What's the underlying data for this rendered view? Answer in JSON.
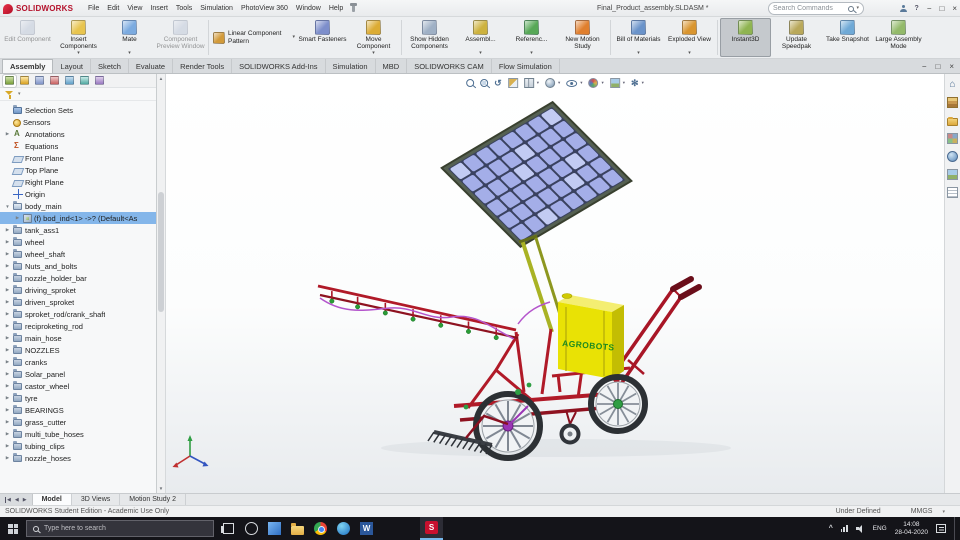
{
  "titlebar": {
    "logo_text": "SOLIDWORKS",
    "menus": [
      "File",
      "Edit",
      "View",
      "Insert",
      "Tools",
      "Simulation",
      "PhotoView 360",
      "Window",
      "Help"
    ],
    "document_title": "Final_Product_assembly.SLDASM *",
    "search_placeholder": "Search Commands",
    "help_label": "?",
    "window_controls": [
      "−",
      "□",
      "×"
    ]
  },
  "ribbon": {
    "buttons": [
      {
        "label": "Edit Component",
        "color": "#b9c3d6",
        "disabled": true
      },
      {
        "label": "Insert Components",
        "color": "#e8c44e",
        "dropdown": true
      },
      {
        "label": "Mate",
        "color": "#7cabe0",
        "dropdown": true
      },
      {
        "label": "Component Preview Window",
        "color": "#b9c3d6",
        "disabled": true
      },
      {
        "sep": true
      },
      {
        "label": "Linear Component Pattern",
        "color": "#d29a3a",
        "dropdown": true,
        "format": "small"
      },
      {
        "label": "Smart Fasteners",
        "color": "#7d8ecb"
      },
      {
        "label": "Move Component",
        "color": "#dcac34",
        "dropdown": true
      },
      {
        "sep": true
      },
      {
        "label": "Show Hidden Components",
        "color": "#9fb0c5"
      },
      {
        "label": "Assembl...",
        "color": "#cdb23e",
        "dropdown": true
      },
      {
        "label": "Referenc...",
        "color": "#57a857",
        "dropdown": true
      },
      {
        "label": "New Motion Study",
        "color": "#e07f2e"
      },
      {
        "sep": true
      },
      {
        "label": "Bill of Materials",
        "color": "#6a93ca",
        "dropdown": true
      },
      {
        "label": "Exploded View",
        "color": "#d9952f",
        "dropdown": true
      },
      {
        "sep": true
      },
      {
        "label": "Instant3D",
        "color": "#8fb451",
        "active": true
      },
      {
        "label": "Update Speedpak",
        "color": "#b9a85a"
      },
      {
        "label": "Take Snapshot",
        "color": "#6fa9d6"
      },
      {
        "label": "Large Assembly Mode",
        "color": "#93ba6a"
      }
    ]
  },
  "command_tabs": {
    "items": [
      "Assembly",
      "Layout",
      "Sketch",
      "Evaluate",
      "Render Tools",
      "SOLIDWORKS Add-Ins",
      "Simulation",
      "MBD",
      "SOLIDWORKS CAM",
      "Flow Simulation"
    ],
    "active": "Assembly",
    "window_controls": [
      "−",
      "□",
      "×"
    ]
  },
  "left_panel": {
    "tab_icons": [
      "feature-manager",
      "property-manager",
      "configuration-manager",
      "dimxpert-manager",
      "display-manager",
      "cam-feature-tree",
      "cam-operation-tree"
    ]
  },
  "feature_tree": {
    "items": [
      {
        "label": "Selection Sets",
        "icon": "selection-sets"
      },
      {
        "label": "Sensors",
        "icon": "sensors"
      },
      {
        "label": "Annotations",
        "icon": "annotations",
        "expand": "collapsed"
      },
      {
        "label": "Equations",
        "icon": "equations"
      },
      {
        "label": "Front Plane",
        "icon": "plane"
      },
      {
        "label": "Top Plane",
        "icon": "plane"
      },
      {
        "label": "Right Plane",
        "icon": "plane"
      },
      {
        "label": "Origin",
        "icon": "origin"
      },
      {
        "label": "body_main",
        "icon": "folder-open",
        "expand": "expanded"
      },
      {
        "label": "(f) bod_ind<1> ->? (Default<As",
        "icon": "part",
        "indent": 1,
        "selected": true,
        "expand": "collapsed"
      },
      {
        "label": "tank_ass1",
        "icon": "folder",
        "expand": "collapsed"
      },
      {
        "label": "wheel",
        "icon": "folder",
        "expand": "collapsed"
      },
      {
        "label": "wheel_shaft",
        "icon": "folder",
        "expand": "collapsed"
      },
      {
        "label": "Nuts_and_bolts",
        "icon": "folder",
        "expand": "collapsed"
      },
      {
        "label": "nozzle_holder_bar",
        "icon": "folder",
        "expand": "collapsed"
      },
      {
        "label": "driving_sproket",
        "icon": "folder",
        "expand": "collapsed"
      },
      {
        "label": "driven_sproket",
        "icon": "folder",
        "expand": "collapsed"
      },
      {
        "label": "sproket_rod/crank_shaft",
        "icon": "folder",
        "expand": "collapsed"
      },
      {
        "label": "reciproketing_rod",
        "icon": "folder",
        "expand": "collapsed"
      },
      {
        "label": "main_hose",
        "icon": "folder",
        "expand": "collapsed"
      },
      {
        "label": "NOZZLES",
        "icon": "folder",
        "expand": "collapsed"
      },
      {
        "label": "cranks",
        "icon": "folder",
        "expand": "collapsed"
      },
      {
        "label": "Solar_panel",
        "icon": "folder",
        "expand": "collapsed"
      },
      {
        "label": "castor_wheel",
        "icon": "folder",
        "expand": "collapsed"
      },
      {
        "label": "tyre",
        "icon": "folder",
        "expand": "collapsed"
      },
      {
        "label": "BEARINGS",
        "icon": "folder",
        "expand": "collapsed"
      },
      {
        "label": "grass_cutter",
        "icon": "folder",
        "expand": "collapsed"
      },
      {
        "label": "multi_tube_hoses",
        "icon": "folder",
        "expand": "collapsed"
      },
      {
        "label": "tubing_clips",
        "icon": "folder",
        "expand": "collapsed"
      },
      {
        "label": "nozzle_hoses",
        "icon": "folder",
        "expand": "collapsed"
      }
    ]
  },
  "viewport": {
    "headsup_icons": [
      "zoom-fit",
      "zoom-area",
      "previous-view",
      "section-view",
      "view-orientation",
      "display-style",
      "hide-show-items",
      "edit-appearance",
      "apply-scene",
      "view-settings"
    ],
    "headsup_dropdowns": [
      "view-orientation",
      "display-style",
      "hide-show-items",
      "edit-appearance",
      "apply-scene",
      "view-settings"
    ]
  },
  "task_pane_icons": [
    "home",
    "design-library",
    "file-explorer",
    "view-palette",
    "appearances",
    "scenes",
    "custom-properties"
  ],
  "model": {
    "tank_label": "AGROBOTS"
  },
  "model_tabs": {
    "items": [
      "Model",
      "3D Views",
      "Motion Study 2"
    ],
    "active": "Model"
  },
  "statusbar": {
    "left": "SOLIDWORKS Student Edition - Academic Use Only",
    "items": [
      "Under Defined",
      "MMGS"
    ]
  },
  "taskbar": {
    "search_placeholder": "Type here to search",
    "apps": [
      "task-view",
      "cortana",
      "photos",
      "file-explorer",
      "chrome",
      "edge",
      "word"
    ],
    "active_app": "solidworks",
    "language": "ENG",
    "time": "14:08",
    "date": "28-04-2020"
  }
}
